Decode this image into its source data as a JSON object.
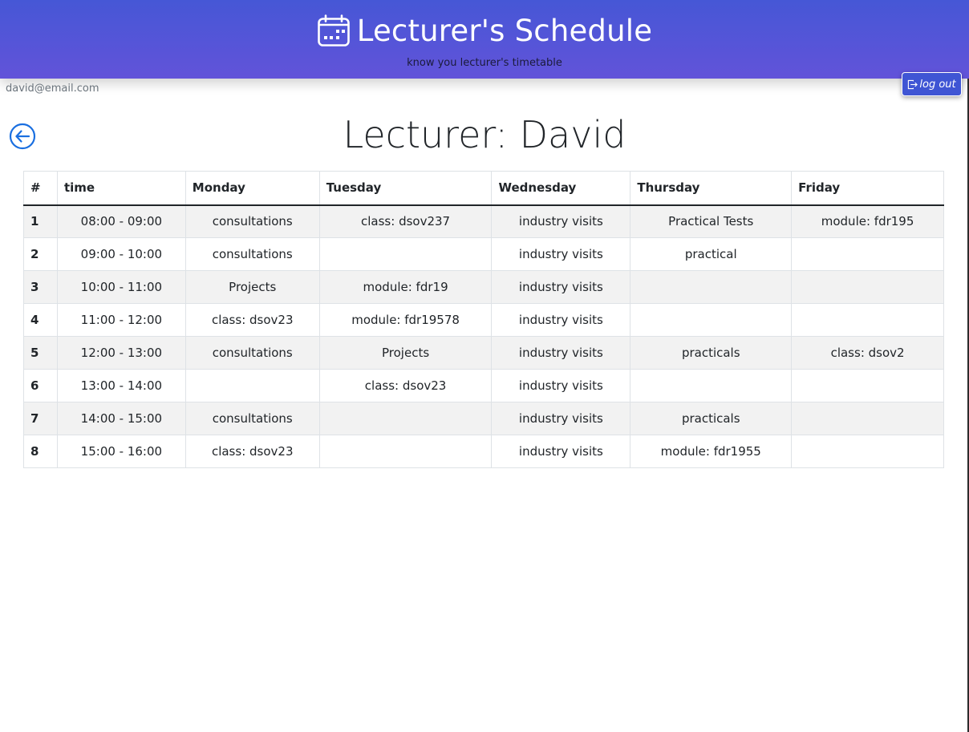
{
  "header": {
    "title": "Lecturer's Schedule",
    "subtitle": "know you lecturer's timetable",
    "icon": "calendar-icon",
    "background": "#4e56d8"
  },
  "user": {
    "email": "david@email.com"
  },
  "logout": {
    "label": "log out",
    "icon": "logout-icon",
    "color": "#3f55d4"
  },
  "back": {
    "icon": "arrow-left-circle-icon",
    "color": "#1a6fe0"
  },
  "page": {
    "title": "Lecturer: David"
  },
  "table": {
    "headers": [
      "#",
      "time",
      "Monday",
      "Tuesday",
      "Wednesday",
      "Thursday",
      "Friday"
    ],
    "rows": [
      [
        "1",
        "08:00 - 09:00",
        "consultations",
        "class: dsov237",
        "industry visits",
        "Practical Tests",
        "module: fdr195"
      ],
      [
        "2",
        "09:00 - 10:00",
        "consultations",
        "",
        "industry visits",
        "practical",
        ""
      ],
      [
        "3",
        "10:00 - 11:00",
        "Projects",
        "module: fdr19",
        "industry visits",
        "",
        ""
      ],
      [
        "4",
        "11:00 - 12:00",
        "class: dsov23",
        "module: fdr19578",
        "industry visits",
        "",
        ""
      ],
      [
        "5",
        "12:00 - 13:00",
        "consultations",
        "Projects",
        "industry visits",
        "practicals",
        "class: dsov2"
      ],
      [
        "6",
        "13:00 - 14:00",
        "",
        "class: dsov23",
        "industry visits",
        "",
        ""
      ],
      [
        "7",
        "14:00 - 15:00",
        "consultations",
        "",
        "industry visits",
        "practicals",
        ""
      ],
      [
        "8",
        "15:00 - 16:00",
        "class: dsov23",
        "",
        "industry visits",
        "module: fdr1955",
        ""
      ]
    ]
  }
}
